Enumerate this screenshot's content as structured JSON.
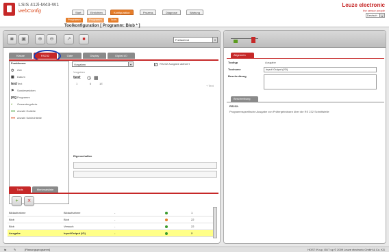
{
  "header": {
    "device": "LSIS 412i-M43-W1",
    "app": "webConfig",
    "brand": "Leuze electronic",
    "brand_tag": "the sensor people",
    "language": "Deutsch",
    "main_tabs": [
      "Start",
      "Einrichten",
      "Konfiguration",
      "Prozess",
      "Diagnose",
      "Wartung"
    ],
    "active_tab": "Konfiguration",
    "sub_tabs": [
      "Programm",
      "Programm",
      "Tools"
    ],
    "page_title": "Toolkonfiguration   [ Programm: Blob * ]"
  },
  "toolbar": {
    "mode": "Freilaufend"
  },
  "group_tabs": [
    "Klasse",
    "RS232",
    "Gate",
    "Display",
    "Digital I/O"
  ],
  "active_group_tab": "RS232",
  "functions": {
    "heading": "Funktionen",
    "items": [
      {
        "icon": "◷",
        "label": "Zeit"
      },
      {
        "icon": "▦",
        "label": "Datum"
      },
      {
        "icon": "text",
        "label": "Text"
      },
      {
        "icon": "⚑",
        "label": "Sonderzeichen"
      },
      {
        "icon": "prg",
        "label": "Programm"
      },
      {
        "icon": "◐",
        "label": "Gesamtergebnis"
      },
      {
        "icon": "●●",
        "label": "Anzahl Gutteile"
      },
      {
        "icon": "●●",
        "label": "Anzahl Schlechtteile"
      }
    ]
  },
  "config": {
    "select": "Vorgaben",
    "checkbox_label": "RS232 Ausgabe aktiviert",
    "preview_label": "Vorgaben",
    "preview_value": "text",
    "preview_nums": [
      "1",
      "6",
      "1E"
    ],
    "side_note": "+ Text",
    "properties_label": "Eigenschaften"
  },
  "workflow": {
    "tabs": [
      "Tools",
      "Merkmalsliste"
    ],
    "rows": [
      {
        "name": "Bildaufnahme",
        "type": "Bildaufnahme",
        "dash": "-",
        "status": "green",
        "num": "1"
      },
      {
        "name": "Blob",
        "type": "Blob",
        "dash": "-",
        "status": "orange",
        "num": "22"
      },
      {
        "name": "Blob",
        "type": "Versuch",
        "dash": "-",
        "status": "green",
        "num": "22"
      },
      {
        "name": "Ausgabe",
        "type": "Input/Output (IO)",
        "dash": "-",
        "status": "green",
        "num": "2"
      }
    ]
  },
  "right": {
    "general_header": "Allgemein",
    "type_label": "Tooltyp",
    "type_value": "Ausgabe",
    "name_label": "Toolname",
    "name_value": "Input/ Output (I/O)",
    "desc_label": "Beschreibung",
    "desc_header": "Beschreibung",
    "desc_title": "RS232:",
    "desc_text": "Programmspezifische Ausgabe von Prüfergebnissen über die RS 232 Schnittstelle"
  },
  "status": {
    "left": "[Planungsprogramm]",
    "right": "HOST IN up, OUT up   © 2009 Leuze electronic GmbH & Co. KG"
  }
}
